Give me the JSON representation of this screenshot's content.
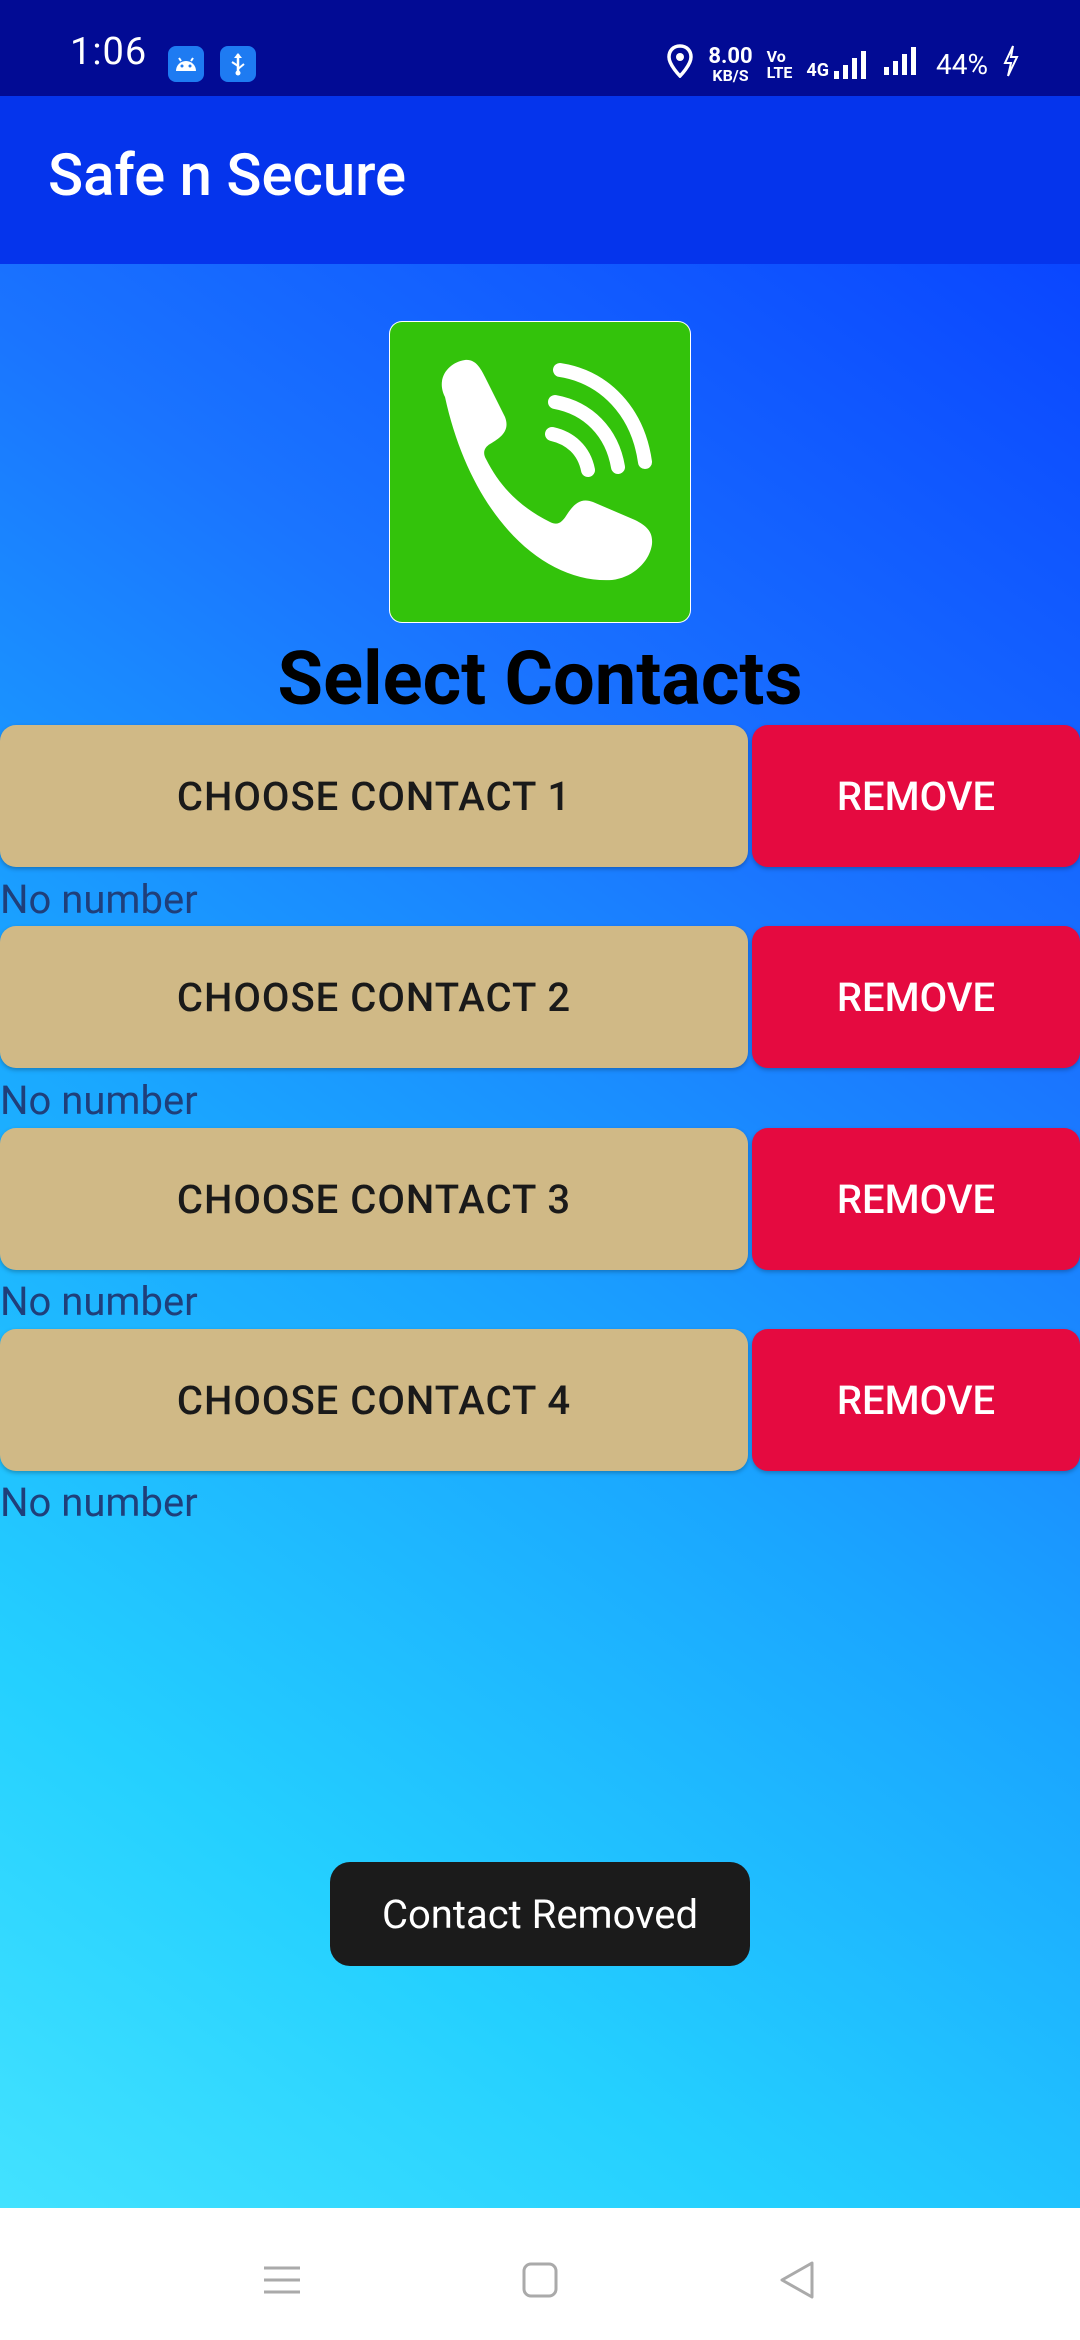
{
  "status_bar": {
    "time": "1:06",
    "net_speed_value": "8.00",
    "net_speed_unit": "KB/S",
    "volte_top": "Vo",
    "volte_bottom": "LTE",
    "network_type": "4G",
    "battery": "44%",
    "icons": [
      "android-debug-icon",
      "usb-icon",
      "location-icon",
      "signal-icon",
      "signal-icon",
      "charging-icon"
    ]
  },
  "app_bar": {
    "title": "Safe n Secure"
  },
  "main": {
    "title": "Select Contacts",
    "contacts": [
      {
        "choose_label": "CHOOSE CONTACT 1",
        "remove_label": "REMOVE",
        "number": "No number"
      },
      {
        "choose_label": "CHOOSE CONTACT 2",
        "remove_label": "REMOVE",
        "number": "No number"
      },
      {
        "choose_label": "CHOOSE CONTACT 3",
        "remove_label": "REMOVE",
        "number": "No number"
      },
      {
        "choose_label": "CHOOSE CONTACT 4",
        "remove_label": "REMOVE",
        "number": "No number"
      }
    ]
  },
  "toast": {
    "message": "Contact Removed"
  },
  "colors": {
    "status_bar": "#020b94",
    "app_bar": "#0534ec",
    "choose_button": "#d0b986",
    "remove_button": "#e50a40",
    "call_icon_bg": "#33c30b"
  }
}
